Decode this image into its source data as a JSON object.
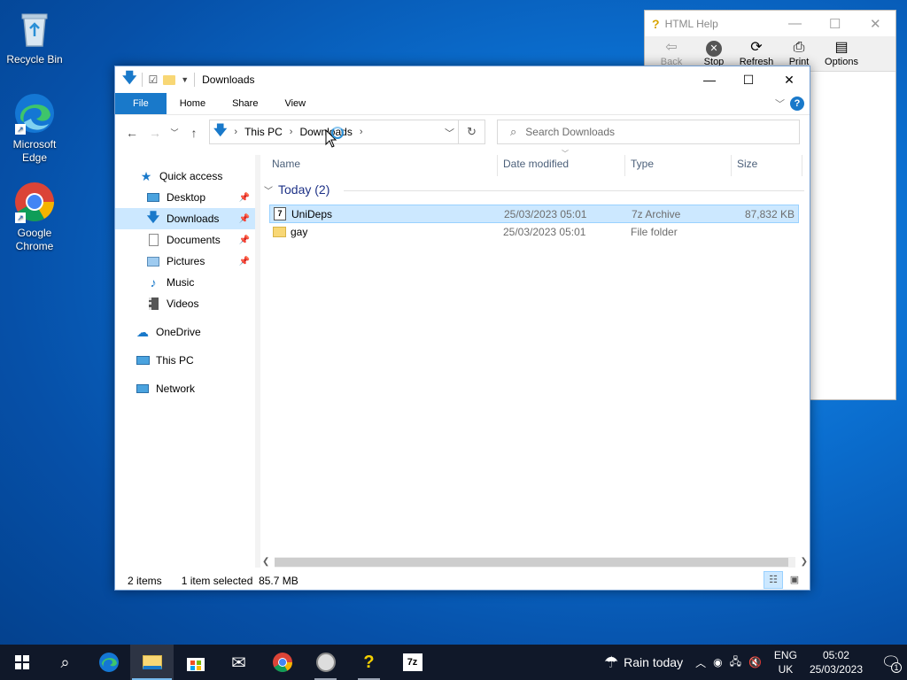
{
  "desktop": {
    "icons": [
      {
        "label": "Recycle Bin"
      },
      {
        "label": "Microsoft Edge"
      },
      {
        "label": "Google Chrome"
      }
    ]
  },
  "help_window": {
    "title": "HTML Help",
    "toolbar": [
      {
        "label": "Back",
        "icon": "back-arrow-icon",
        "enabled": false
      },
      {
        "label": "Stop",
        "icon": "stop-icon",
        "enabled": true
      },
      {
        "label": "Refresh",
        "icon": "refresh-icon",
        "enabled": true
      },
      {
        "label": "Print",
        "icon": "printer-icon",
        "enabled": true
      },
      {
        "label": "Options",
        "icon": "options-icon",
        "enabled": true
      }
    ]
  },
  "explorer": {
    "title": "Downloads",
    "ribbon_tabs": [
      "File",
      "Home",
      "Share",
      "View"
    ],
    "help_label": "?",
    "address": {
      "crumbs": [
        "This PC",
        "Downloads"
      ]
    },
    "search_placeholder": "Search Downloads",
    "sidebar": [
      {
        "label": "Quick access",
        "icon": "star-icon",
        "pinned": false,
        "selected": false
      },
      {
        "label": "Desktop",
        "icon": "desktop-icon",
        "pinned": true,
        "selected": false
      },
      {
        "label": "Downloads",
        "icon": "download-arrow-icon",
        "pinned": true,
        "selected": true
      },
      {
        "label": "Documents",
        "icon": "document-icon",
        "pinned": true,
        "selected": false
      },
      {
        "label": "Pictures",
        "icon": "picture-icon",
        "pinned": true,
        "selected": false
      },
      {
        "label": "Music",
        "icon": "music-note-icon",
        "pinned": false,
        "selected": false
      },
      {
        "label": "Videos",
        "icon": "film-icon",
        "pinned": false,
        "selected": false
      },
      {
        "label": "OneDrive",
        "icon": "cloud-icon",
        "pinned": false,
        "selected": false
      },
      {
        "label": "This PC",
        "icon": "computer-icon",
        "pinned": false,
        "selected": false
      },
      {
        "label": "Network",
        "icon": "network-icon",
        "pinned": false,
        "selected": false
      }
    ],
    "columns": [
      "Name",
      "Date modified",
      "Type",
      "Size"
    ],
    "group_label": "Today (2)",
    "files": [
      {
        "name": "UniDeps",
        "date": "25/03/2023 05:01",
        "type": "7z Archive",
        "size": "87,832 KB",
        "selected": true
      },
      {
        "name": "gay",
        "date": "25/03/2023 05:01",
        "type": "File folder",
        "size": "",
        "selected": false
      }
    ],
    "status": {
      "items": "2 items",
      "selection": "1 item selected  85.7 MB"
    }
  },
  "taskbar": {
    "weather": "Rain today",
    "lang_top": "ENG",
    "lang_bottom": "UK",
    "time": "05:02",
    "date": "25/03/2023",
    "notification_count": "1"
  },
  "colors": {
    "accent": "#1979ca",
    "selection": "#cce8ff"
  }
}
